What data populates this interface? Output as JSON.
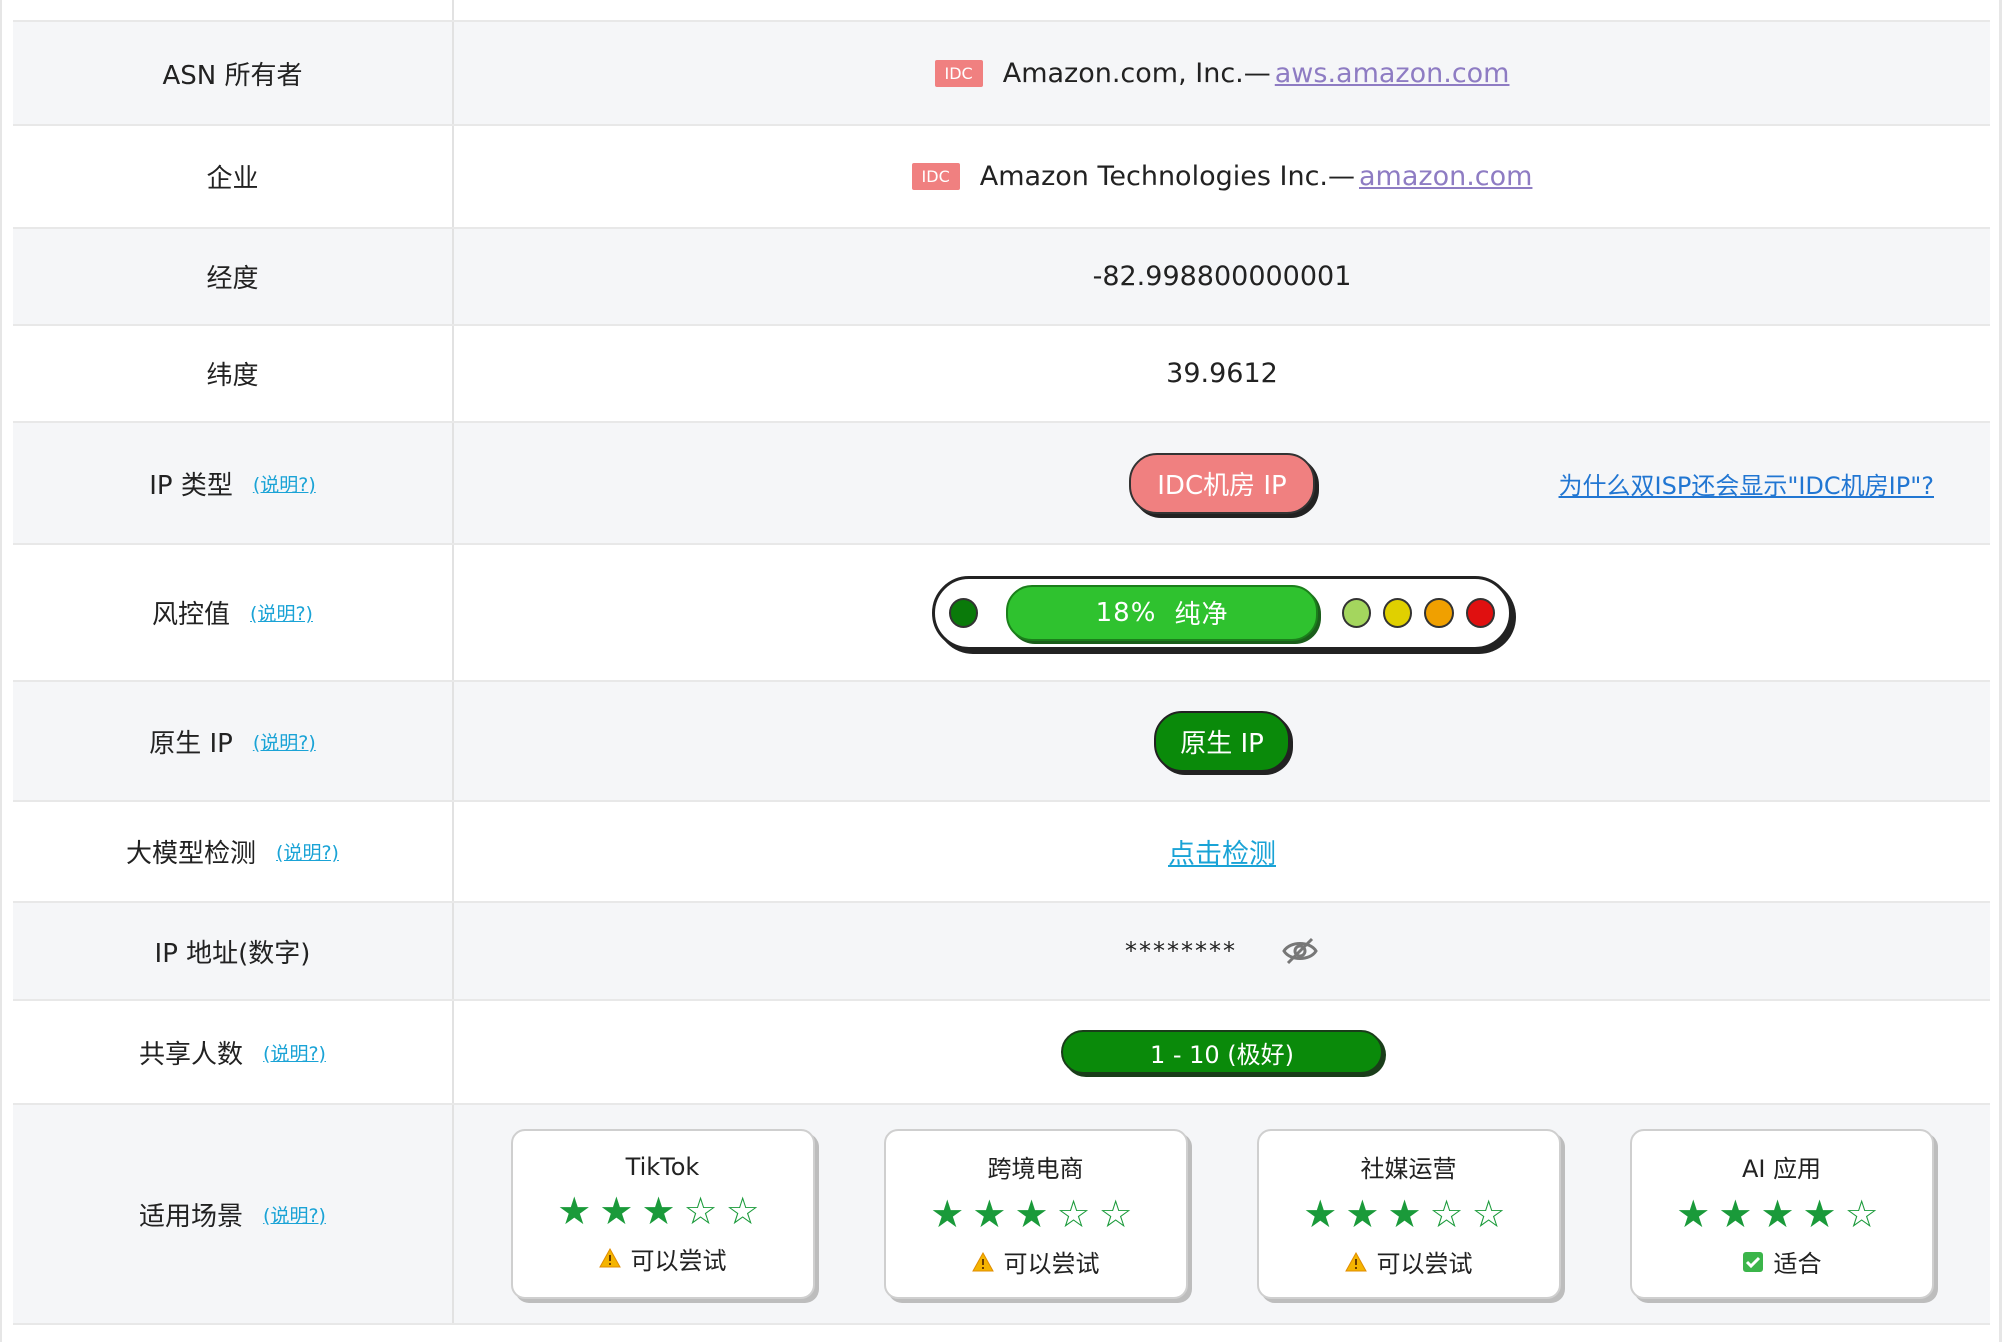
{
  "rows": {
    "asn": {
      "label": "ASN 所有者",
      "tag": "IDC",
      "name": "Amazon.com, Inc.—",
      "link": "aws.amazon.com"
    },
    "company": {
      "label": "企业",
      "tag": "IDC",
      "name": "Amazon Technologies Inc.—",
      "link": "amazon.com"
    },
    "longitude": {
      "label": "经度",
      "value": "-82.998800000001"
    },
    "latitude": {
      "label": "纬度",
      "value": "39.9612"
    },
    "ip_type": {
      "label": "IP 类型",
      "help": "(说明?)",
      "badge": "IDC机房 IP",
      "why_link": "为什么双ISP还会显示\"IDC机房IP\"?"
    },
    "risk": {
      "label": "风控值",
      "help": "(说明?)",
      "percent": "18%",
      "verdict": "纯净",
      "level": 0.18,
      "dot_colors": [
        "#0a7a0a",
        "#a4d65e",
        "#e0d000",
        "#f0a000",
        "#e01010"
      ]
    },
    "native": {
      "label": "原生 IP",
      "help": "(说明?)",
      "badge": "原生 IP"
    },
    "llm": {
      "label": "大模型检测",
      "help": "(说明?)",
      "action": "点击检测"
    },
    "ip_number": {
      "label": "IP 地址(数字)",
      "masked": "********",
      "icon": "eye-off-icon"
    },
    "shared": {
      "label": "共享人数",
      "help": "(说明?)",
      "value": "1 - 10 (极好)"
    },
    "scenes": {
      "label": "适用场景",
      "help": "(说明?)",
      "cards": [
        {
          "title": "TikTok",
          "stars": 3,
          "max": 5,
          "verdict": "可以尝试",
          "icon": "warning-icon"
        },
        {
          "title": "跨境电商",
          "stars": 3,
          "max": 5,
          "verdict": "可以尝试",
          "icon": "warning-icon"
        },
        {
          "title": "社媒运营",
          "stars": 3,
          "max": 5,
          "verdict": "可以尝试",
          "icon": "warning-icon"
        },
        {
          "title": "AI 应用",
          "stars": 4,
          "max": 5,
          "verdict": "适合",
          "icon": "checkmark-icon"
        }
      ]
    }
  },
  "colors": {
    "idc_red": "#f08080",
    "native_green": "#0a8a0a",
    "star_green": "#1a9a3a",
    "link_blue": "#1aa3d6"
  }
}
